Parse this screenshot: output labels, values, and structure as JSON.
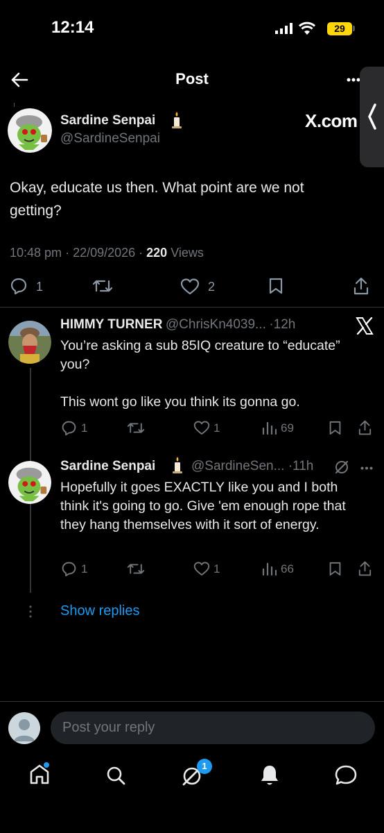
{
  "status_bar": {
    "time": "12:14",
    "battery": "29"
  },
  "header": {
    "title": "Post"
  },
  "main_post": {
    "author_name": "Sardine Senpai",
    "author_handle": "@SardineSenpai",
    "source_label": "X.com",
    "text": "Okay, educate us then. What point are we not getting?",
    "time": "10:48 pm",
    "date": "22/09/2026",
    "views_count": "220",
    "views_label": "Views",
    "replies": "1",
    "likes": "2"
  },
  "replies": [
    {
      "author_name": "HIMMY TURNER",
      "author_handle": "@ChrisKn4039...",
      "age": "12h",
      "paragraphs": [
        "You’re asking a sub 85IQ creature to “educate” you?",
        "This wont go like you think its gonna go."
      ],
      "replies": "1",
      "likes": "1",
      "views": "69"
    },
    {
      "author_name": "Sardine Senpai",
      "author_handle": "@SardineSen...",
      "age": "11h",
      "paragraphs": [
        "Hopefully it goes EXACTLY like you and I both think it's going to go. Give 'em enough rope that they hang themselves with it sort of energy."
      ],
      "replies": "1",
      "likes": "1",
      "views": "66"
    }
  ],
  "show_replies": "Show replies",
  "composer": {
    "placeholder": "Post your reply"
  },
  "bottom_nav": {
    "messages_badge": "1"
  },
  "colors": {
    "accent": "#1d9bf0",
    "background": "#000000",
    "muted": "#71767b",
    "battery": "#ffd60a"
  }
}
